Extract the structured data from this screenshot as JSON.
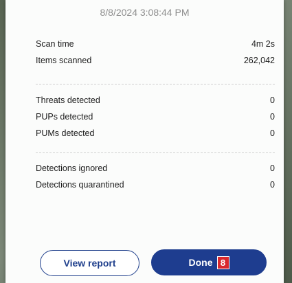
{
  "timestamp": "8/8/2024 3:08:44 PM",
  "scan_info": [
    {
      "label": "Scan time",
      "value": "4m 2s"
    },
    {
      "label": "Items scanned",
      "value": "262,042"
    }
  ],
  "detections": [
    {
      "label": "Threats detected",
      "value": "0"
    },
    {
      "label": "PUPs detected",
      "value": "0"
    },
    {
      "label": "PUMs detected",
      "value": "0"
    }
  ],
  "handled": [
    {
      "label": "Detections ignored",
      "value": "0"
    },
    {
      "label": "Detections quarantined",
      "value": "0"
    }
  ],
  "buttons": {
    "view_report": "View report",
    "done": "Done",
    "done_badge": "8"
  },
  "colors": {
    "primary": "#1e3d8f",
    "badge": "#d9282e"
  }
}
